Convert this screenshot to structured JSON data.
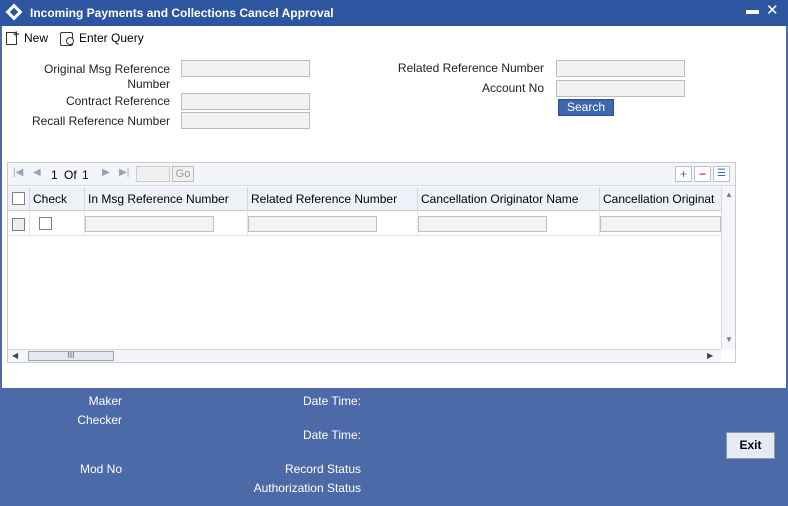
{
  "window": {
    "title": "Incoming Payments and Collections Cancel Approval",
    "minimize_glyph": "▬",
    "close_glyph": "✕"
  },
  "toolbar": {
    "new_label": "New",
    "enter_query_label": "Enter Query"
  },
  "form": {
    "original_msg_ref_label_line1": "Original Msg Reference",
    "original_msg_ref_label_line2": "Number",
    "contract_ref_label": "Contract Reference",
    "recall_ref_label": "Recall Reference Number",
    "related_ref_label": "Related Reference Number",
    "account_no_label": "Account No",
    "original_msg_ref_value": "",
    "contract_ref_value": "",
    "recall_ref_value": "",
    "related_ref_value": "",
    "account_no_value": "",
    "search_label": "Search"
  },
  "grid": {
    "pager": {
      "current": "1",
      "of": "Of",
      "total": "1",
      "go_label": "Go"
    },
    "columns": [
      "Check",
      "In Msg Reference Number",
      "Related Reference Number",
      "Cancellation Originator Name",
      "Cancellation Originat"
    ],
    "rows": [
      {
        "in_msg_ref": "",
        "related_ref": "",
        "cancel_orig_name": "",
        "cancel_orig": ""
      }
    ],
    "scroll_thumb_glyph": "III"
  },
  "footer": {
    "maker_label": "Maker",
    "checker_label": "Checker",
    "date_time_label_1": "Date Time:",
    "date_time_label_2": "Date Time:",
    "mod_no_label": "Mod No",
    "record_status_label": "Record Status",
    "authorization_status_label": "Authorization Status",
    "exit_label": "Exit"
  },
  "colors": {
    "title_bar": "#2d55a0",
    "footer_bg": "#4c6aa8",
    "accent_button": "#3f66ad"
  },
  "icons": [
    "window-diamond-icon",
    "minimize-icon",
    "close-icon",
    "new-document-icon",
    "enter-query-icon",
    "first-page-icon",
    "previous-page-icon",
    "next-page-icon",
    "last-page-icon",
    "add-row-icon",
    "delete-row-icon",
    "single-view-icon"
  ]
}
